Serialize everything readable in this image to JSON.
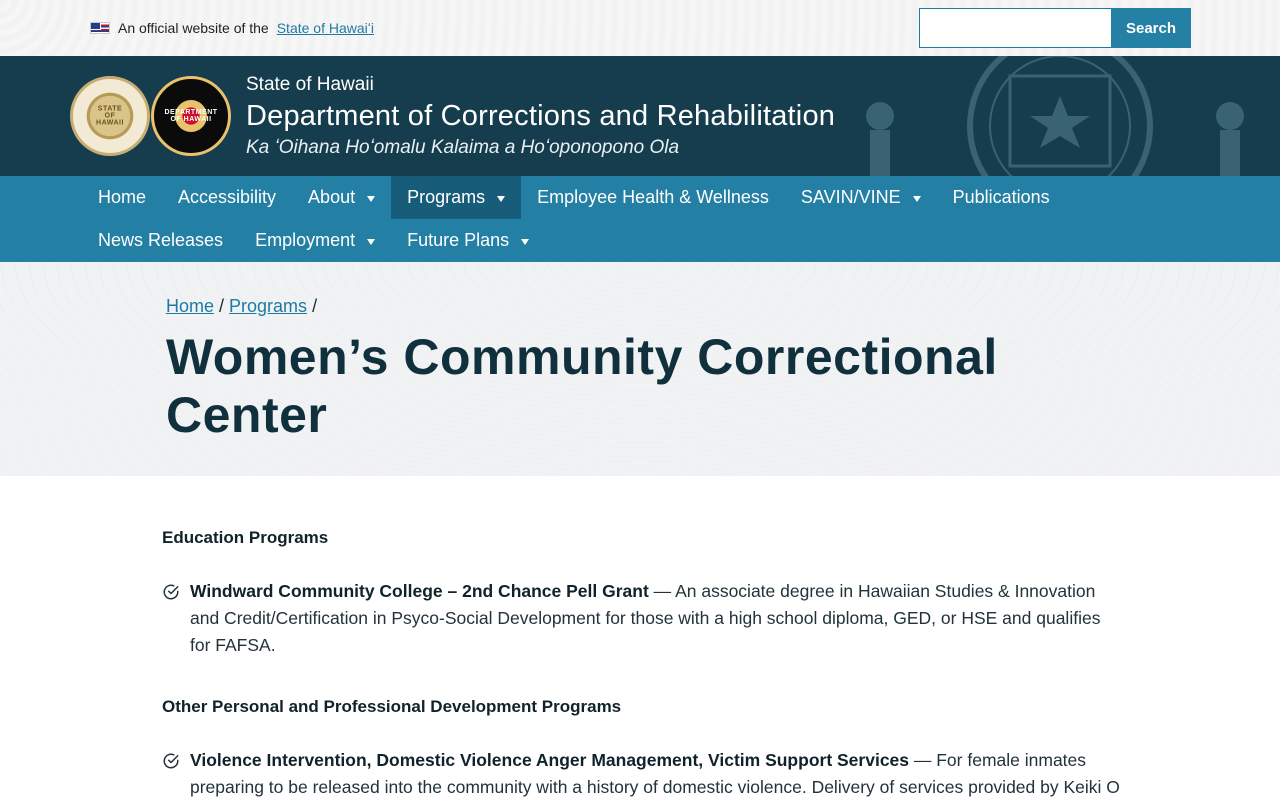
{
  "topbar": {
    "official_prefix": "An official website of the",
    "official_link": "State of Hawaiʻi",
    "search_placeholder": "",
    "search_button": "Search"
  },
  "header": {
    "state": "State of Hawaii",
    "department": "Department of Corrections and Rehabilitation",
    "hawaiian_name": "Ka ʻOihana Hoʻomalu Kalaima a Hoʻoponopono Ola",
    "seal_1_text": "STATE OF HAWAII",
    "seal_2_text": "DEPARTMENT OF HAWAII"
  },
  "nav": {
    "row1": [
      {
        "label": "Home",
        "has_dropdown": false,
        "active": false
      },
      {
        "label": "Accessibility",
        "has_dropdown": false,
        "active": false
      },
      {
        "label": "About",
        "has_dropdown": true,
        "active": false
      },
      {
        "label": "Programs",
        "has_dropdown": true,
        "active": true
      },
      {
        "label": "Employee Health & Wellness",
        "has_dropdown": false,
        "active": false
      },
      {
        "label": "SAVIN/VINE",
        "has_dropdown": true,
        "active": false
      },
      {
        "label": "Publications",
        "has_dropdown": false,
        "active": false
      }
    ],
    "row2": [
      {
        "label": "News Releases",
        "has_dropdown": false,
        "active": false
      },
      {
        "label": "Employment",
        "has_dropdown": true,
        "active": false
      },
      {
        "label": "Future Plans",
        "has_dropdown": true,
        "active": false
      }
    ]
  },
  "breadcrumb": {
    "home": "Home",
    "sep1": " / ",
    "programs": "Programs",
    "sep2": " /"
  },
  "page": {
    "title": "Women’s Community Correctional Center"
  },
  "content": {
    "education_heading": "Education Programs",
    "education_items": [
      {
        "name": "Windward Community College – 2nd Chance Pell Grant",
        "description": " — An associate degree in Hawaiian Studies & Innovation and Credit/Certification in Psyco-Social Development for those with a high school diploma, GED, or HSE and qualifies for FAFSA."
      }
    ],
    "other_heading": "Other Personal and Professional Development Programs",
    "other_items": [
      {
        "name": "Violence Intervention, Domestic Violence Anger Management, Victim Support Services",
        "description": " — For female inmates preparing to be released into the community with a history of domestic violence. Delivery of services provided by Keiki O Ka Aina."
      }
    ]
  },
  "colors": {
    "nav_bg": "#237fa3",
    "nav_active": "#175c78",
    "banner_bg": "#163d4d",
    "link": "#1f7aa2",
    "title": "#10303d"
  },
  "icons": {
    "check": "check-circle-icon",
    "flag": "hawaii-flag-icon",
    "caret": "caret-down-icon"
  }
}
